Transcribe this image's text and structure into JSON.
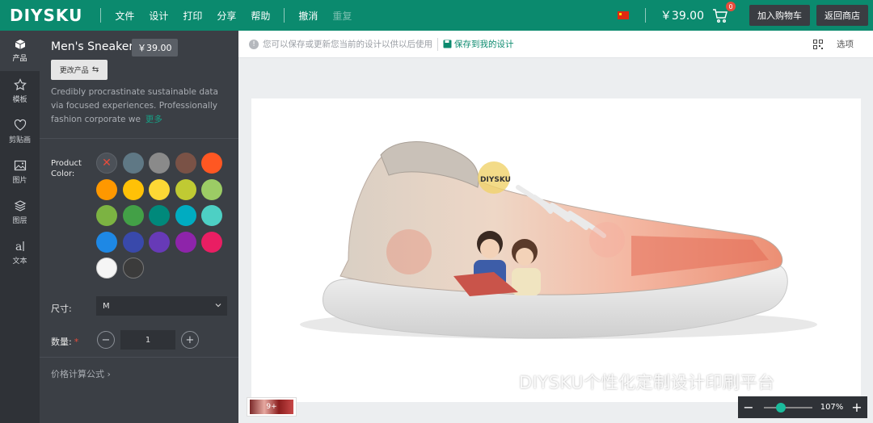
{
  "topbar": {
    "logo": "DIYSKU",
    "menu": [
      "文件",
      "设计",
      "打印",
      "分享",
      "帮助"
    ],
    "undo": "撤消",
    "redo": "重复",
    "price": "￥39.00",
    "cart_count": "0",
    "add_to_cart": "加入购物车",
    "back_to_store": "返回商店",
    "accent_color": "#0b8a6e"
  },
  "rail": [
    {
      "label": "产品",
      "icon": "cube-icon"
    },
    {
      "label": "模板",
      "icon": "star-icon"
    },
    {
      "label": "剪贴画",
      "icon": "heart-icon"
    },
    {
      "label": "图片",
      "icon": "image-icon"
    },
    {
      "label": "图层",
      "icon": "layers-icon"
    },
    {
      "label": "文本",
      "icon": "text-icon"
    }
  ],
  "product": {
    "title": "Men's Sneaker",
    "price": "￥39.00",
    "change_button": "更改产品",
    "description": "Credibly procrastinate sustainable data via focused experiences. Professionally fashion corporate we",
    "more": "更多",
    "color_label": "Product Color:",
    "colors": [
      "#5f7885",
      "#8a8a8a",
      "#7a5246",
      "#ff5722",
      "#ff9800",
      "#ffc107",
      "#fdd835",
      "#c0ca33",
      "#9ccc65",
      "#7cb342",
      "#43a047",
      "#00897b",
      "#00acc1",
      "#4dd0c4",
      "#1e88e5",
      "#3949ab",
      "#673ab7",
      "#8e24aa",
      "#e91e63",
      "#f5f5f5",
      "#3b3b3b"
    ],
    "size_label": "尺寸:",
    "size_value": "M",
    "qty_label": "数量:",
    "qty_required": "*",
    "qty_value": "1",
    "formula": "价格计算公式"
  },
  "infobar": {
    "message": "您可以保存或更新您当前的设计以供以后使用",
    "save": "保存到我的设计",
    "options": "选项"
  },
  "canvas": {
    "shoe_logo": "DIYSKU",
    "thumb_label": "9+"
  },
  "watermark": "DIYSKU个性化定制设计印刷平台",
  "zoom": {
    "percent": "107%",
    "level": 0.35
  }
}
